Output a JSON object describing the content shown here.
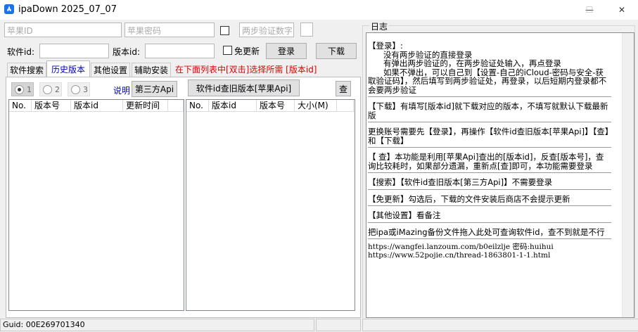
{
  "window": {
    "title": "ipaDown 2025_07_07",
    "minimize": "—",
    "maximize": "☐",
    "close": "✕"
  },
  "login": {
    "apple_id_placeholder": "苹果ID",
    "password_placeholder": "苹果密码",
    "two_step_placeholder": "两步验证数字"
  },
  "download_row": {
    "app_id_label": "软件id:",
    "version_id_label": "版本id:",
    "no_update_label": "免更新",
    "login_button": "登录",
    "download_button": "下载"
  },
  "tabs": [
    {
      "label": "软件搜索",
      "active": false
    },
    {
      "label": "历史版本",
      "active": true
    },
    {
      "label": "其他设置",
      "active": false
    },
    {
      "label": "辅助安装",
      "active": false
    }
  ],
  "hint": "在下面列表中[双击]选择所需 [版本id]",
  "history": {
    "radios": [
      "1",
      "2",
      "3"
    ],
    "help_link": "说明",
    "third_party_button": "第三方Api",
    "left_columns": [
      "No.",
      "版本号",
      "版本id",
      "更新时间"
    ],
    "query_button": "软件id查旧版本[苹果Api]",
    "check_button": "查",
    "right_columns": [
      "No.",
      "版本id",
      "版本号",
      "大小(M)"
    ]
  },
  "log": {
    "title": "日志",
    "paragraphs": [
      "【登录】:\n      没有两步验证的直接登录\n      有弹出两步验证的，在两步验证处输入，再点登录\n      如果不弹出，可以自己到【设置-自己的iCloud-密码与安全-获取验证码】，然后填写到两步验证处，再登录，以后短期内登录都不会要两步验证",
      "【下载】有填写[版本id]就下载对应的版本，不填写就默认下载最新版",
      "更换账号需要先【登录】，再操作【软件id查旧版本[苹果Api]】【查】和【下载】",
      "【 查】本功能是利用[苹果Api]查出的[版本id]，反查[版本号]，查询比较耗时，如果部分遗漏，重新点[查]即可，本功能需要登录",
      "【搜索】【软件id查旧版本[第三方Api]】不需要登录",
      "【免更新】勾选后，下载的文件安装后商店不会提示更新",
      "【其他设置】看备注",
      "把ipa或iMazing备份文件拖入此处可查询软件id，查不到就是不行"
    ],
    "urls": [
      "https://wangfei.lanzoum.com/b0eilzlje 密码:huihui",
      "https://www.52pojie.cn/thread-1863801-1-1.html"
    ]
  },
  "status": {
    "guid": "Guid: 00E269701340"
  },
  "colors": {
    "accent": "#0000cc",
    "hint": "#e00000",
    "app_icon": "#1a73e8"
  }
}
